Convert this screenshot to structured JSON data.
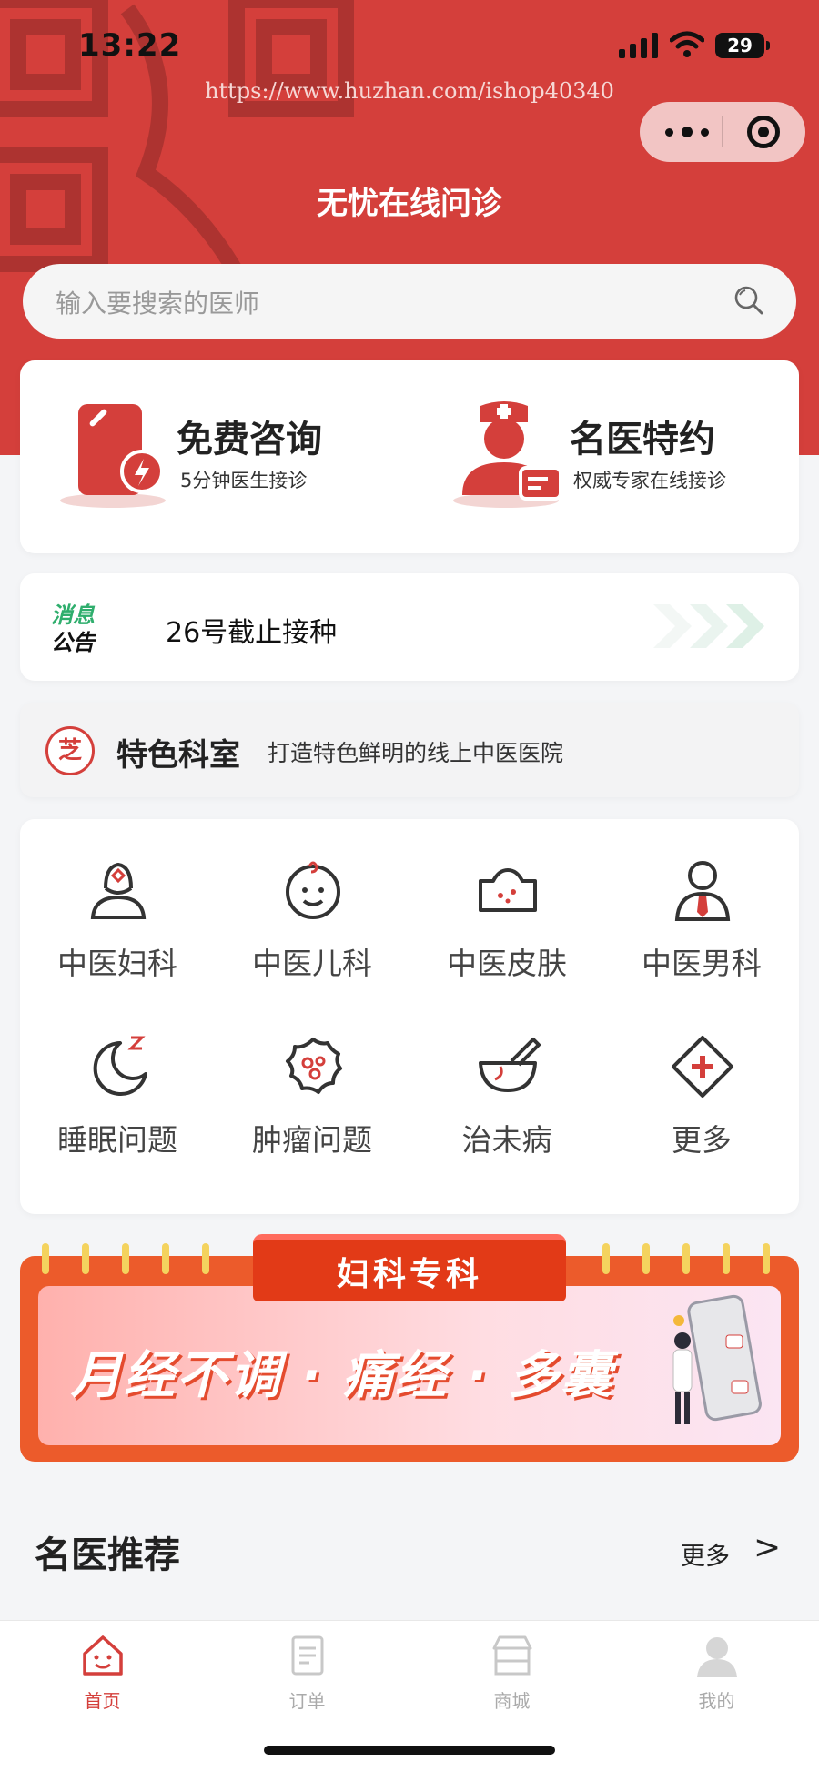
{
  "status_bar": {
    "time": "13:22",
    "battery": "29"
  },
  "watermark": "https://www.huzhan.com/ishop40340",
  "header": {
    "title": "无忧在线问诊"
  },
  "search": {
    "placeholder": "输入要搜索的医师"
  },
  "consult": [
    {
      "title": "免费咨询",
      "subtitle": "5分钟医生接诊"
    },
    {
      "title": "名医特约",
      "subtitle": "权威专家在线接诊"
    }
  ],
  "notice": {
    "badge_top": "消息",
    "badge_bottom": "公告",
    "text": "26号截止接种"
  },
  "feature": {
    "logo_char": "芝",
    "heading": "特色科室",
    "subtitle": "打造特色鲜明的线上中医医院"
  },
  "departments": [
    {
      "label": "中医妇科",
      "icon": "female-doctor-icon"
    },
    {
      "label": "中医儿科",
      "icon": "baby-face-icon"
    },
    {
      "label": "中医皮肤",
      "icon": "skin-icon"
    },
    {
      "label": "中医男科",
      "icon": "male-icon"
    },
    {
      "label": "睡眠问题",
      "icon": "moon-sleep-icon"
    },
    {
      "label": "肿瘤问题",
      "icon": "tumor-icon"
    },
    {
      "label": "治未病",
      "icon": "mortar-icon"
    },
    {
      "label": "更多",
      "icon": "more-plus-icon"
    }
  ],
  "banner": {
    "tab": "妇科专科",
    "slogan": "月经不调 · 痛经 · 多囊"
  },
  "recommend": {
    "title": "名医推荐",
    "more": "更多",
    "arrow": ">"
  },
  "tabbar": [
    {
      "label": "首页",
      "active": true
    },
    {
      "label": "订单",
      "active": false
    },
    {
      "label": "商城",
      "active": false
    },
    {
      "label": "我的",
      "active": false
    }
  ],
  "colors": {
    "brand": "#d43f3b",
    "green": "#2fae6d",
    "banner_orange": "#ec5b2b"
  }
}
